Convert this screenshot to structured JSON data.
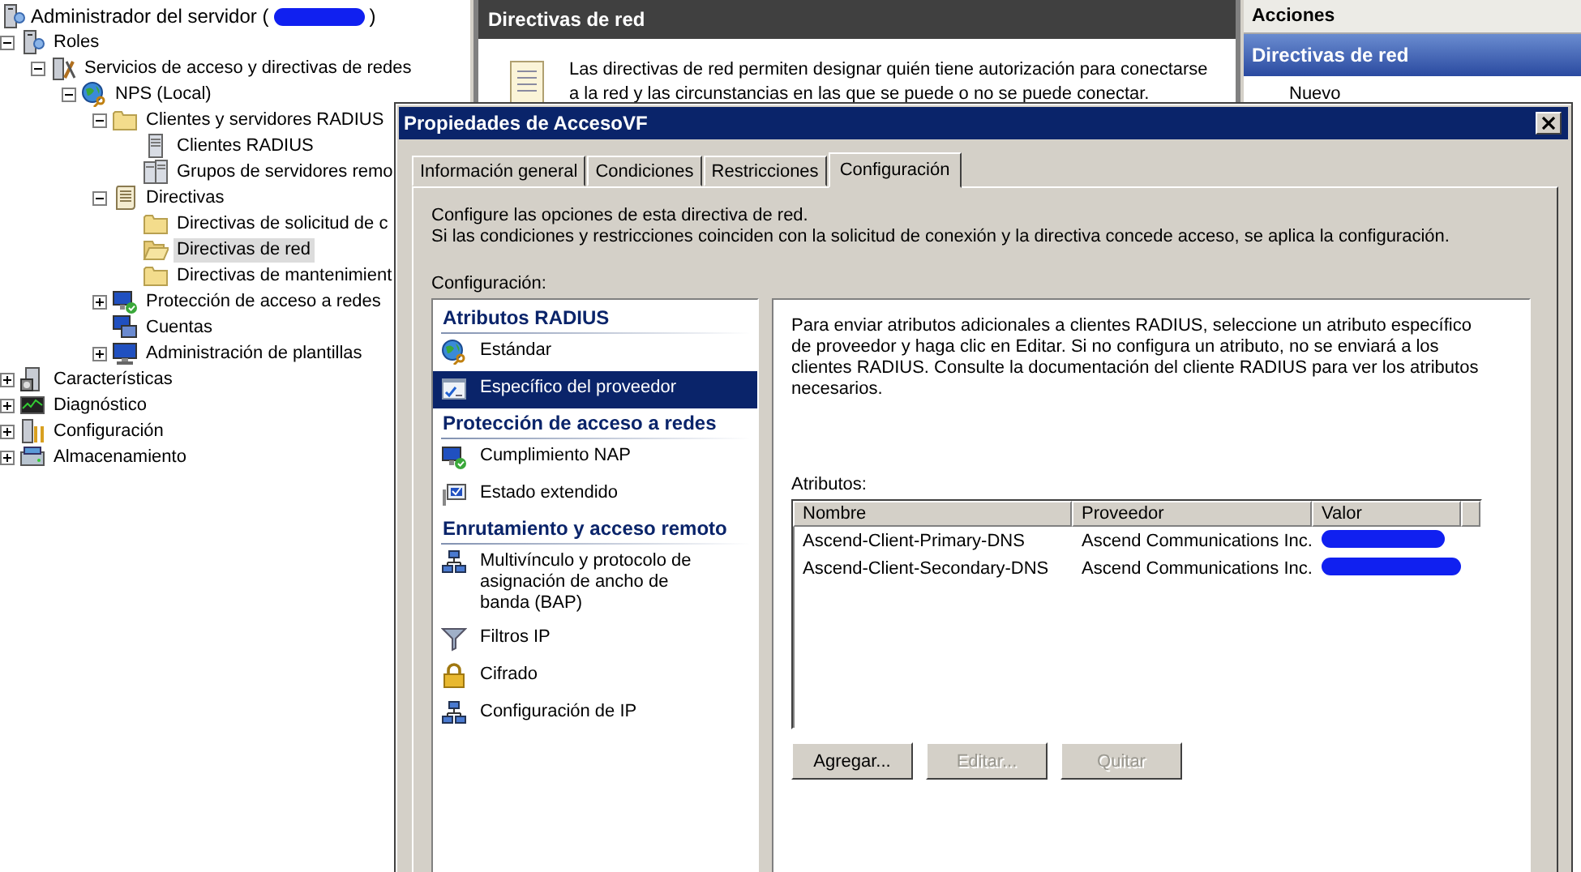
{
  "tree": {
    "title_prefix": "Administrador del servidor (",
    "title_redacted": true,
    "title_suffix": ")",
    "items": [
      {
        "label": "Roles",
        "kind": "roles",
        "expanded": true,
        "selected": false,
        "children": [
          {
            "label": "Servicios de acceso y directivas de redes",
            "kind": "nps-role",
            "expanded": true,
            "selected": false,
            "children": [
              {
                "label": "NPS (Local)",
                "kind": "globe",
                "expanded": true,
                "selected": false,
                "children": [
                  {
                    "label": "Clientes y servidores RADIUS",
                    "kind": "folder",
                    "expanded": true,
                    "selected": false,
                    "children": [
                      {
                        "label": "Clientes RADIUS",
                        "kind": "server",
                        "selected": false
                      },
                      {
                        "label": "Grupos de servidores remo",
                        "kind": "servers",
                        "selected": false
                      }
                    ]
                  },
                  {
                    "label": "Directivas",
                    "kind": "scroll",
                    "expanded": true,
                    "selected": false,
                    "children": [
                      {
                        "label": "Directivas de solicitud de c",
                        "kind": "folder",
                        "selected": false
                      },
                      {
                        "label": "Directivas de red",
                        "kind": "open-folder",
                        "selected": true
                      },
                      {
                        "label": "Directivas de mantenimient",
                        "kind": "folder",
                        "selected": false
                      }
                    ]
                  },
                  {
                    "label": "Protección de acceso a redes",
                    "kind": "monitor-check",
                    "expanded": false,
                    "selected": false
                  },
                  {
                    "label": "Cuentas",
                    "kind": "monitors",
                    "selected": false
                  },
                  {
                    "label": "Administración de plantillas",
                    "kind": "monitor",
                    "expanded": false,
                    "selected": false
                  }
                ]
              }
            ]
          }
        ]
      },
      {
        "label": "Características",
        "kind": "features",
        "expanded": false,
        "selected": false
      },
      {
        "label": "Diagnóstico",
        "kind": "diagnostic",
        "expanded": false,
        "selected": false
      },
      {
        "label": "Configuración",
        "kind": "tools",
        "expanded": false,
        "selected": false
      },
      {
        "label": "Almacenamiento",
        "kind": "storage",
        "expanded": false,
        "selected": false
      }
    ]
  },
  "center": {
    "title": "Directivas de red",
    "description": "Las directivas de red permiten designar quién tiene autorización para conectarse a la red y las circunstancias en las que se puede o no se puede conectar."
  },
  "actions": {
    "title": "Acciones",
    "section": "Directivas de red",
    "items": [
      "Nuevo"
    ]
  },
  "dialog": {
    "title": "Propiedades de AccesoVF",
    "tabs": [
      {
        "label": "Información general",
        "selected": false
      },
      {
        "label": "Condiciones",
        "selected": false
      },
      {
        "label": "Restricciones",
        "selected": false
      },
      {
        "label": "Configuración",
        "selected": true
      }
    ],
    "intro": [
      "Configure las opciones de esta directiva de red.",
      "Si las condiciones y restricciones coinciden con la solicitud de conexión y la directiva concede acceso, se aplica la configuración."
    ],
    "settings_label": "Configuración:",
    "settings": [
      {
        "heading": "Atributos RADIUS",
        "items": [
          {
            "label": "Estándar",
            "kind": "globe",
            "selected": false
          },
          {
            "label": "Específico del proveedor",
            "kind": "checklist",
            "selected": true
          }
        ]
      },
      {
        "heading": "Protección de acceso a redes",
        "items": [
          {
            "label": "Cumplimiento NAP",
            "kind": "monitor-check",
            "selected": false
          },
          {
            "label": "Estado extendido",
            "kind": "monitor-state",
            "selected": false
          }
        ]
      },
      {
        "heading": "Enrutamiento y acceso remoto",
        "items": [
          {
            "label": "Multivínculo y protocolo de asignación de ancho de banda (BAP)",
            "kind": "network",
            "selected": false
          },
          {
            "label": "Filtros IP",
            "kind": "funnel",
            "selected": false
          },
          {
            "label": "Cifrado",
            "kind": "lock",
            "selected": false
          },
          {
            "label": "Configuración de IP",
            "kind": "network",
            "selected": false
          }
        ]
      }
    ],
    "detail": {
      "description": "Para enviar atributos adicionales a clientes RADIUS, seleccione un atributo específico de proveedor y haga clic en Editar. Si no configura un atributo, no se enviará a los clientes RADIUS. Consulte la documentación del cliente RADIUS para ver los atributos necesarios.",
      "list_label": "Atributos:",
      "columns": [
        "Nombre",
        "Proveedor",
        "Valor"
      ],
      "rows": [
        {
          "name": "Ascend-Client-Primary-DNS",
          "vendor": "Ascend Communications Inc.",
          "value_redacted": true
        },
        {
          "name": "Ascend-Client-Secondary-DNS",
          "vendor": "Ascend Communications Inc.",
          "value_redacted": true
        }
      ],
      "buttons": [
        {
          "label": "Agregar...",
          "disabled": false
        },
        {
          "label": "Editar...",
          "disabled": true
        },
        {
          "label": "Quitar",
          "disabled": true
        }
      ]
    }
  }
}
